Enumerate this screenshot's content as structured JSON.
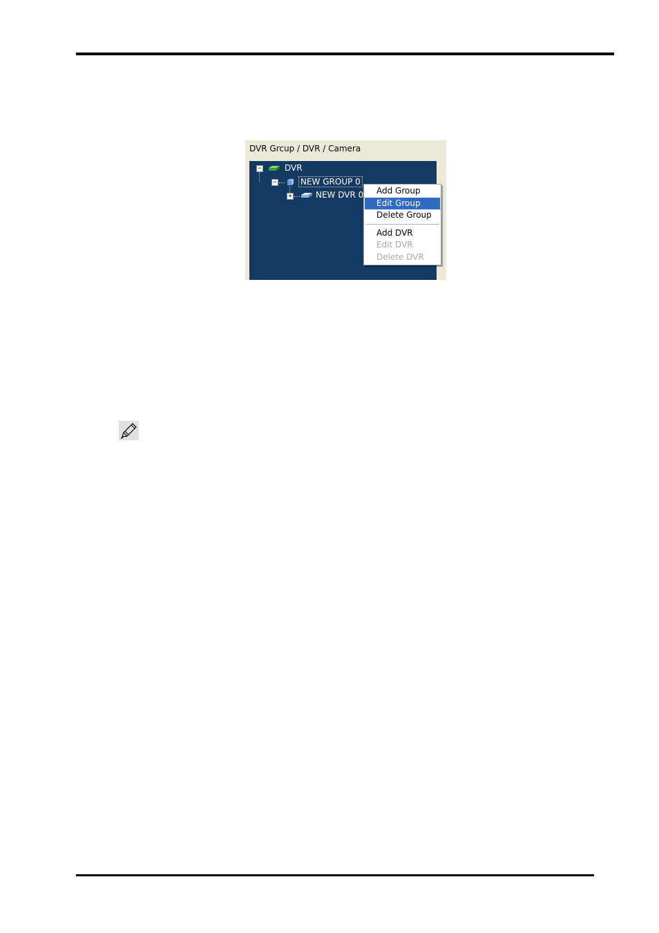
{
  "panel": {
    "title": "DVR Grcup / DVR / Camera",
    "tree": {
      "root": "DVR",
      "group": "NEW GROUP 0",
      "dvr": "NEW DVR 0"
    }
  },
  "context_menu": {
    "items": [
      {
        "label": "Add Group",
        "state": "normal"
      },
      {
        "label": "Edit Group",
        "state": "highlighted"
      },
      {
        "label": "Delete Group",
        "state": "normal"
      },
      {
        "label": "Add DVR",
        "state": "normal"
      },
      {
        "label": "Edit DVR",
        "state": "disabled"
      },
      {
        "label": "Delete DVR",
        "state": "disabled"
      }
    ]
  },
  "icons": {
    "root_icon": "dvr-green-icon",
    "group_icon": "folder-icon",
    "dvr_icon": "dvr-device-icon",
    "note_icon": "pencil-note-icon"
  },
  "colors": {
    "tree_bg": "#123a63",
    "menu_highlight": "#316ac5"
  }
}
